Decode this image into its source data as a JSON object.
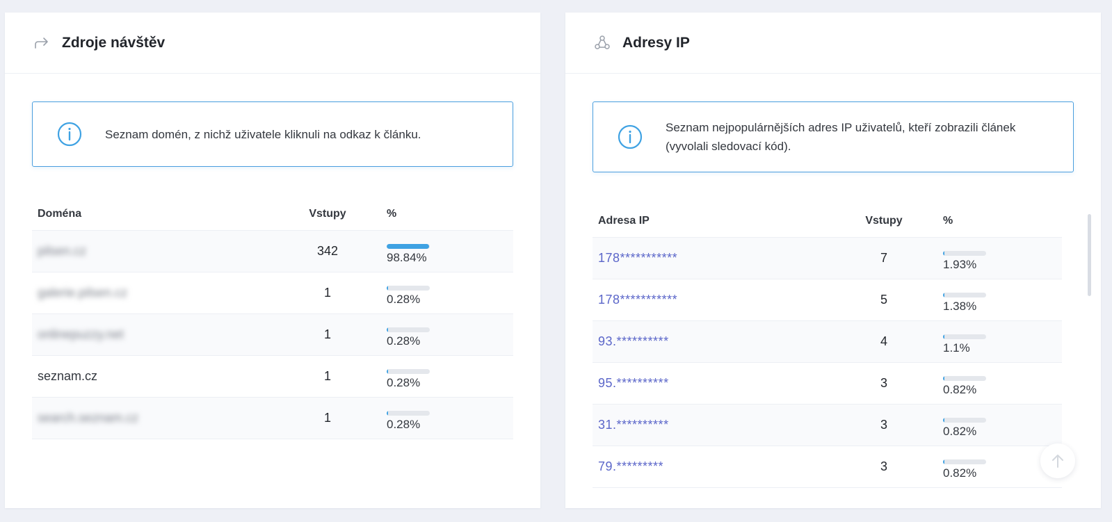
{
  "left_panel": {
    "title": "Zdroje návštěv",
    "icon": "share-arrow-icon",
    "info": "Seznam domén, z nichž uživatele kliknuli na odkaz k článku.",
    "columns": [
      "Doména",
      "Vstupy",
      "%"
    ],
    "rows": [
      {
        "domain": "pilsen.cz",
        "visits": "342",
        "percent": "98.84%",
        "fill": 0.9884,
        "blurred": true
      },
      {
        "domain": "galerie.pilsen.cz",
        "visits": "1",
        "percent": "0.28%",
        "fill": 0.0028,
        "blurred": true
      },
      {
        "domain": "onlinepuzzy.net",
        "visits": "1",
        "percent": "0.28%",
        "fill": 0.0028,
        "blurred": true
      },
      {
        "domain": "seznam.cz",
        "visits": "1",
        "percent": "0.28%",
        "fill": 0.0028,
        "blurred": false
      },
      {
        "domain": "search.seznam.cz",
        "visits": "1",
        "percent": "0.28%",
        "fill": 0.0028,
        "blurred": true
      }
    ]
  },
  "right_panel": {
    "title": "Adresy IP",
    "icon": "network-icon",
    "info": "Seznam nejpopulárnějších adres IP uživatelů, kteří zobrazili článek (vyvolali sledovací kód).",
    "columns": [
      "Adresa IP",
      "Vstupy",
      "%"
    ],
    "rows": [
      {
        "ip": "178***********",
        "visits": "7",
        "percent": "1.93%",
        "fill": 0.0193
      },
      {
        "ip": "178***********",
        "visits": "5",
        "percent": "1.38%",
        "fill": 0.0138
      },
      {
        "ip": "93.**********",
        "visits": "4",
        "percent": "1.1%",
        "fill": 0.011
      },
      {
        "ip": "95.**********",
        "visits": "3",
        "percent": "0.82%",
        "fill": 0.0082
      },
      {
        "ip": "31.**********",
        "visits": "3",
        "percent": "0.82%",
        "fill": 0.0082
      },
      {
        "ip": "79.*********",
        "visits": "3",
        "percent": "0.82%",
        "fill": 0.0082
      }
    ]
  },
  "colors": {
    "accent": "#3fa2e3",
    "link": "#5b66c9",
    "bar_bg": "#e4e7ec"
  }
}
